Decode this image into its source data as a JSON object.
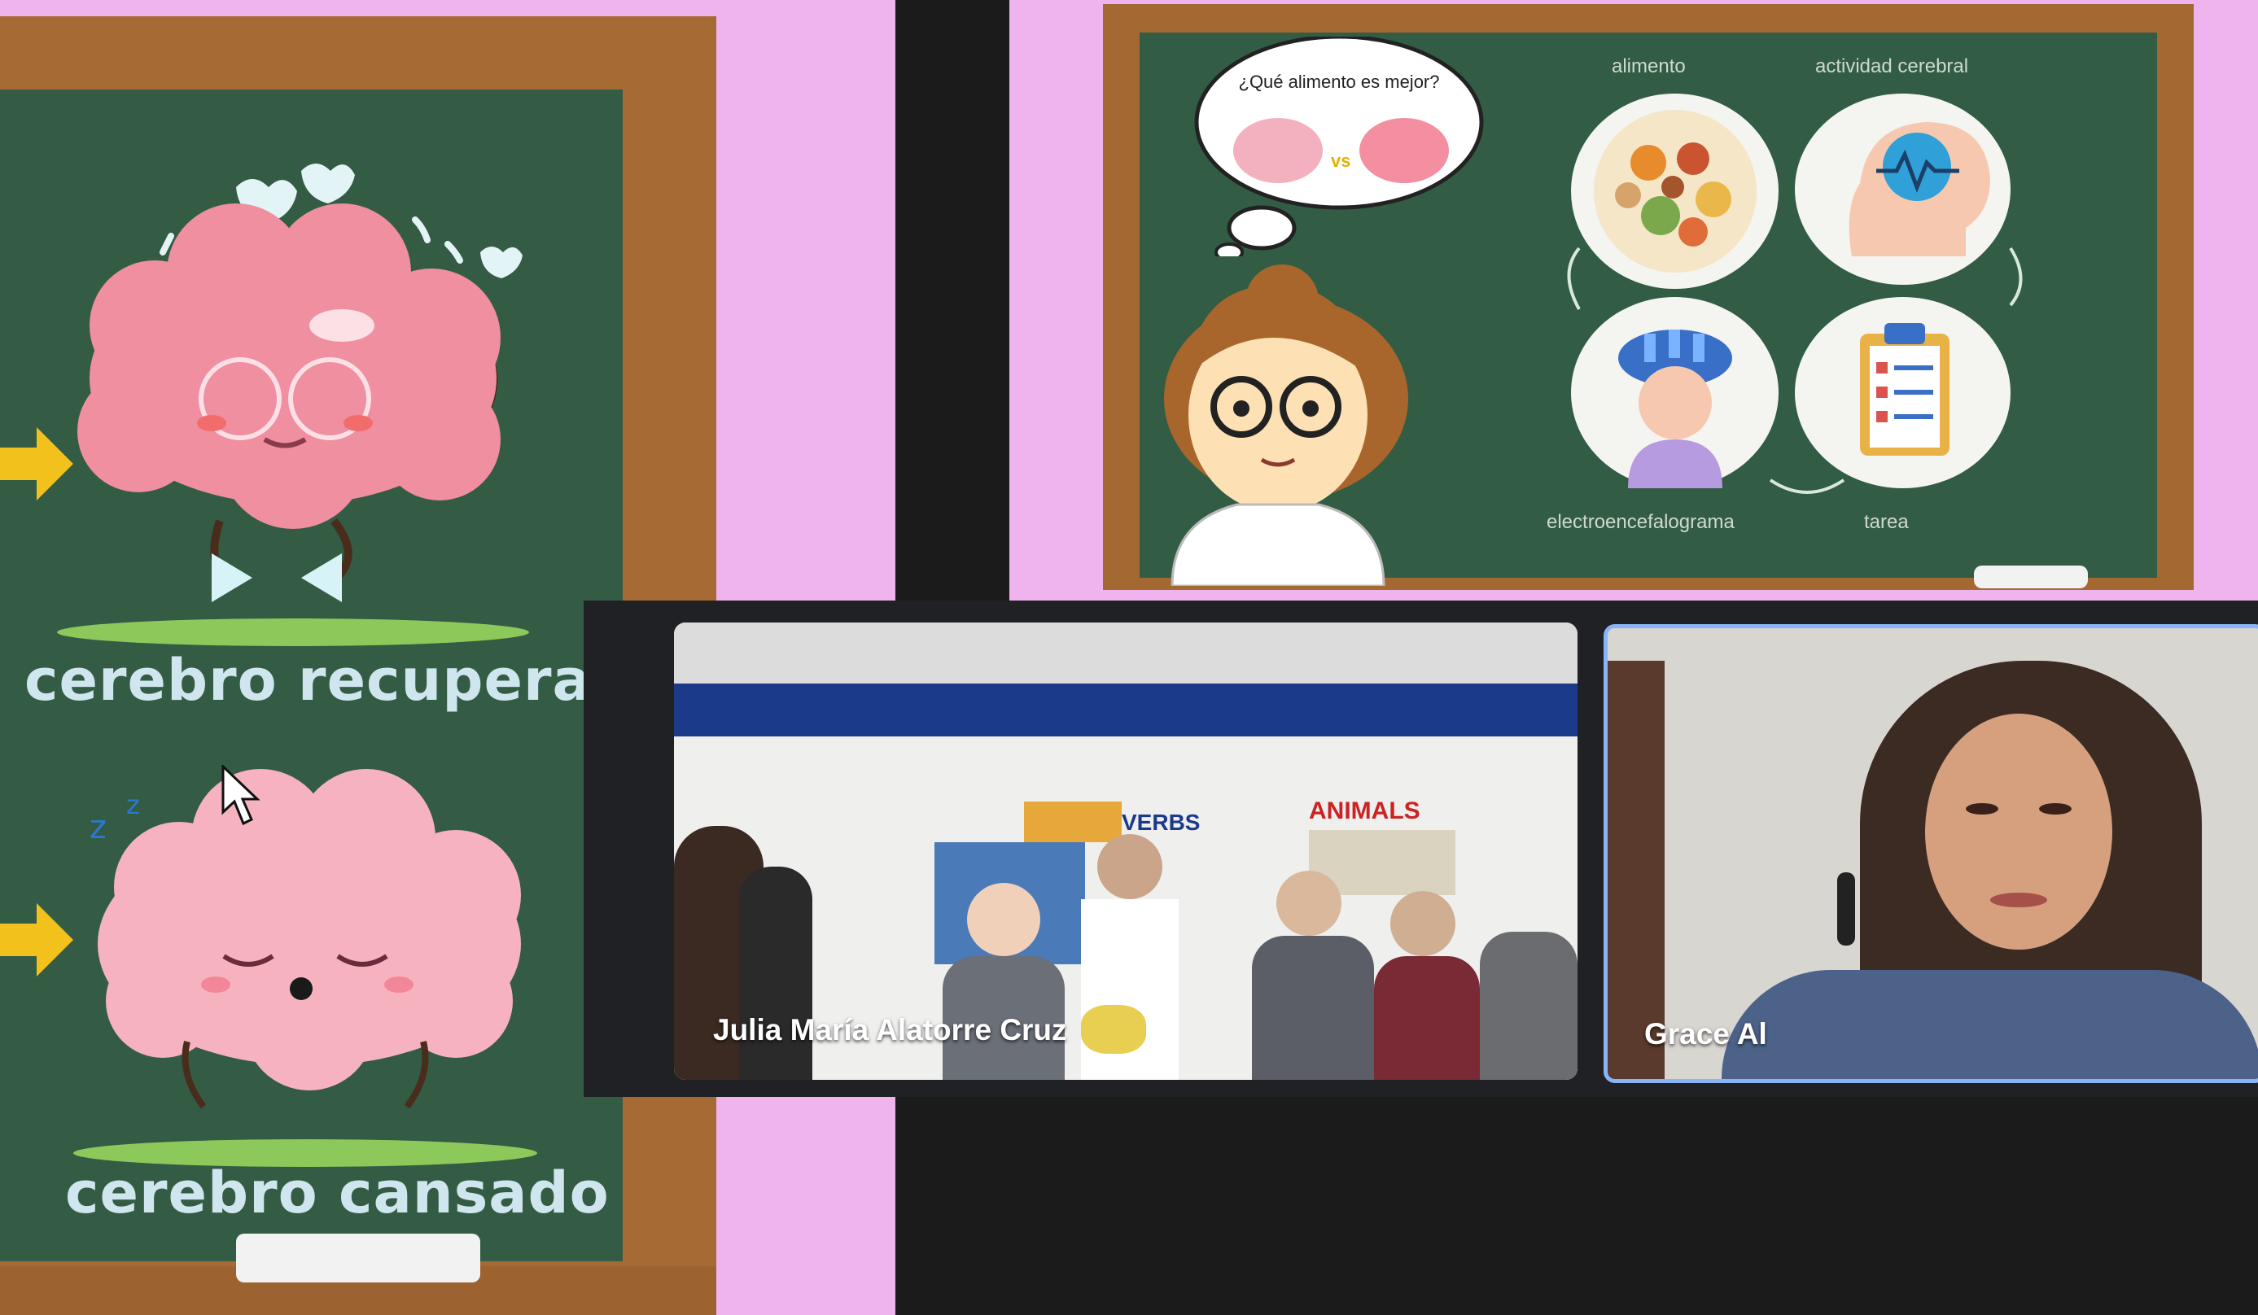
{
  "left_slide": {
    "label_top": "cerebro recuperado",
    "label_bottom": "cerebro cansado"
  },
  "right_slide": {
    "speech_bubble": "¿Qué alimento es mejor?",
    "icon_label_top_left": "alimento",
    "icon_label_top_right": "actividad cerebral",
    "icon_label_bottom_left": "electroencefalograma",
    "icon_label_bottom_right": "tarea",
    "classroom_poster": "ANIMALS",
    "classroom_poster_2": "VERBS"
  },
  "participants": [
    {
      "name": "Julia María Alatorre Cruz",
      "active_speaker": false
    },
    {
      "name": "Grace Al",
      "active_speaker": true
    }
  ],
  "colors": {
    "accent_active_speaker": "#8ab4f8",
    "chalkboard": "#345c45",
    "slide_background": "#efb3ee",
    "meeting_background": "#202124"
  }
}
